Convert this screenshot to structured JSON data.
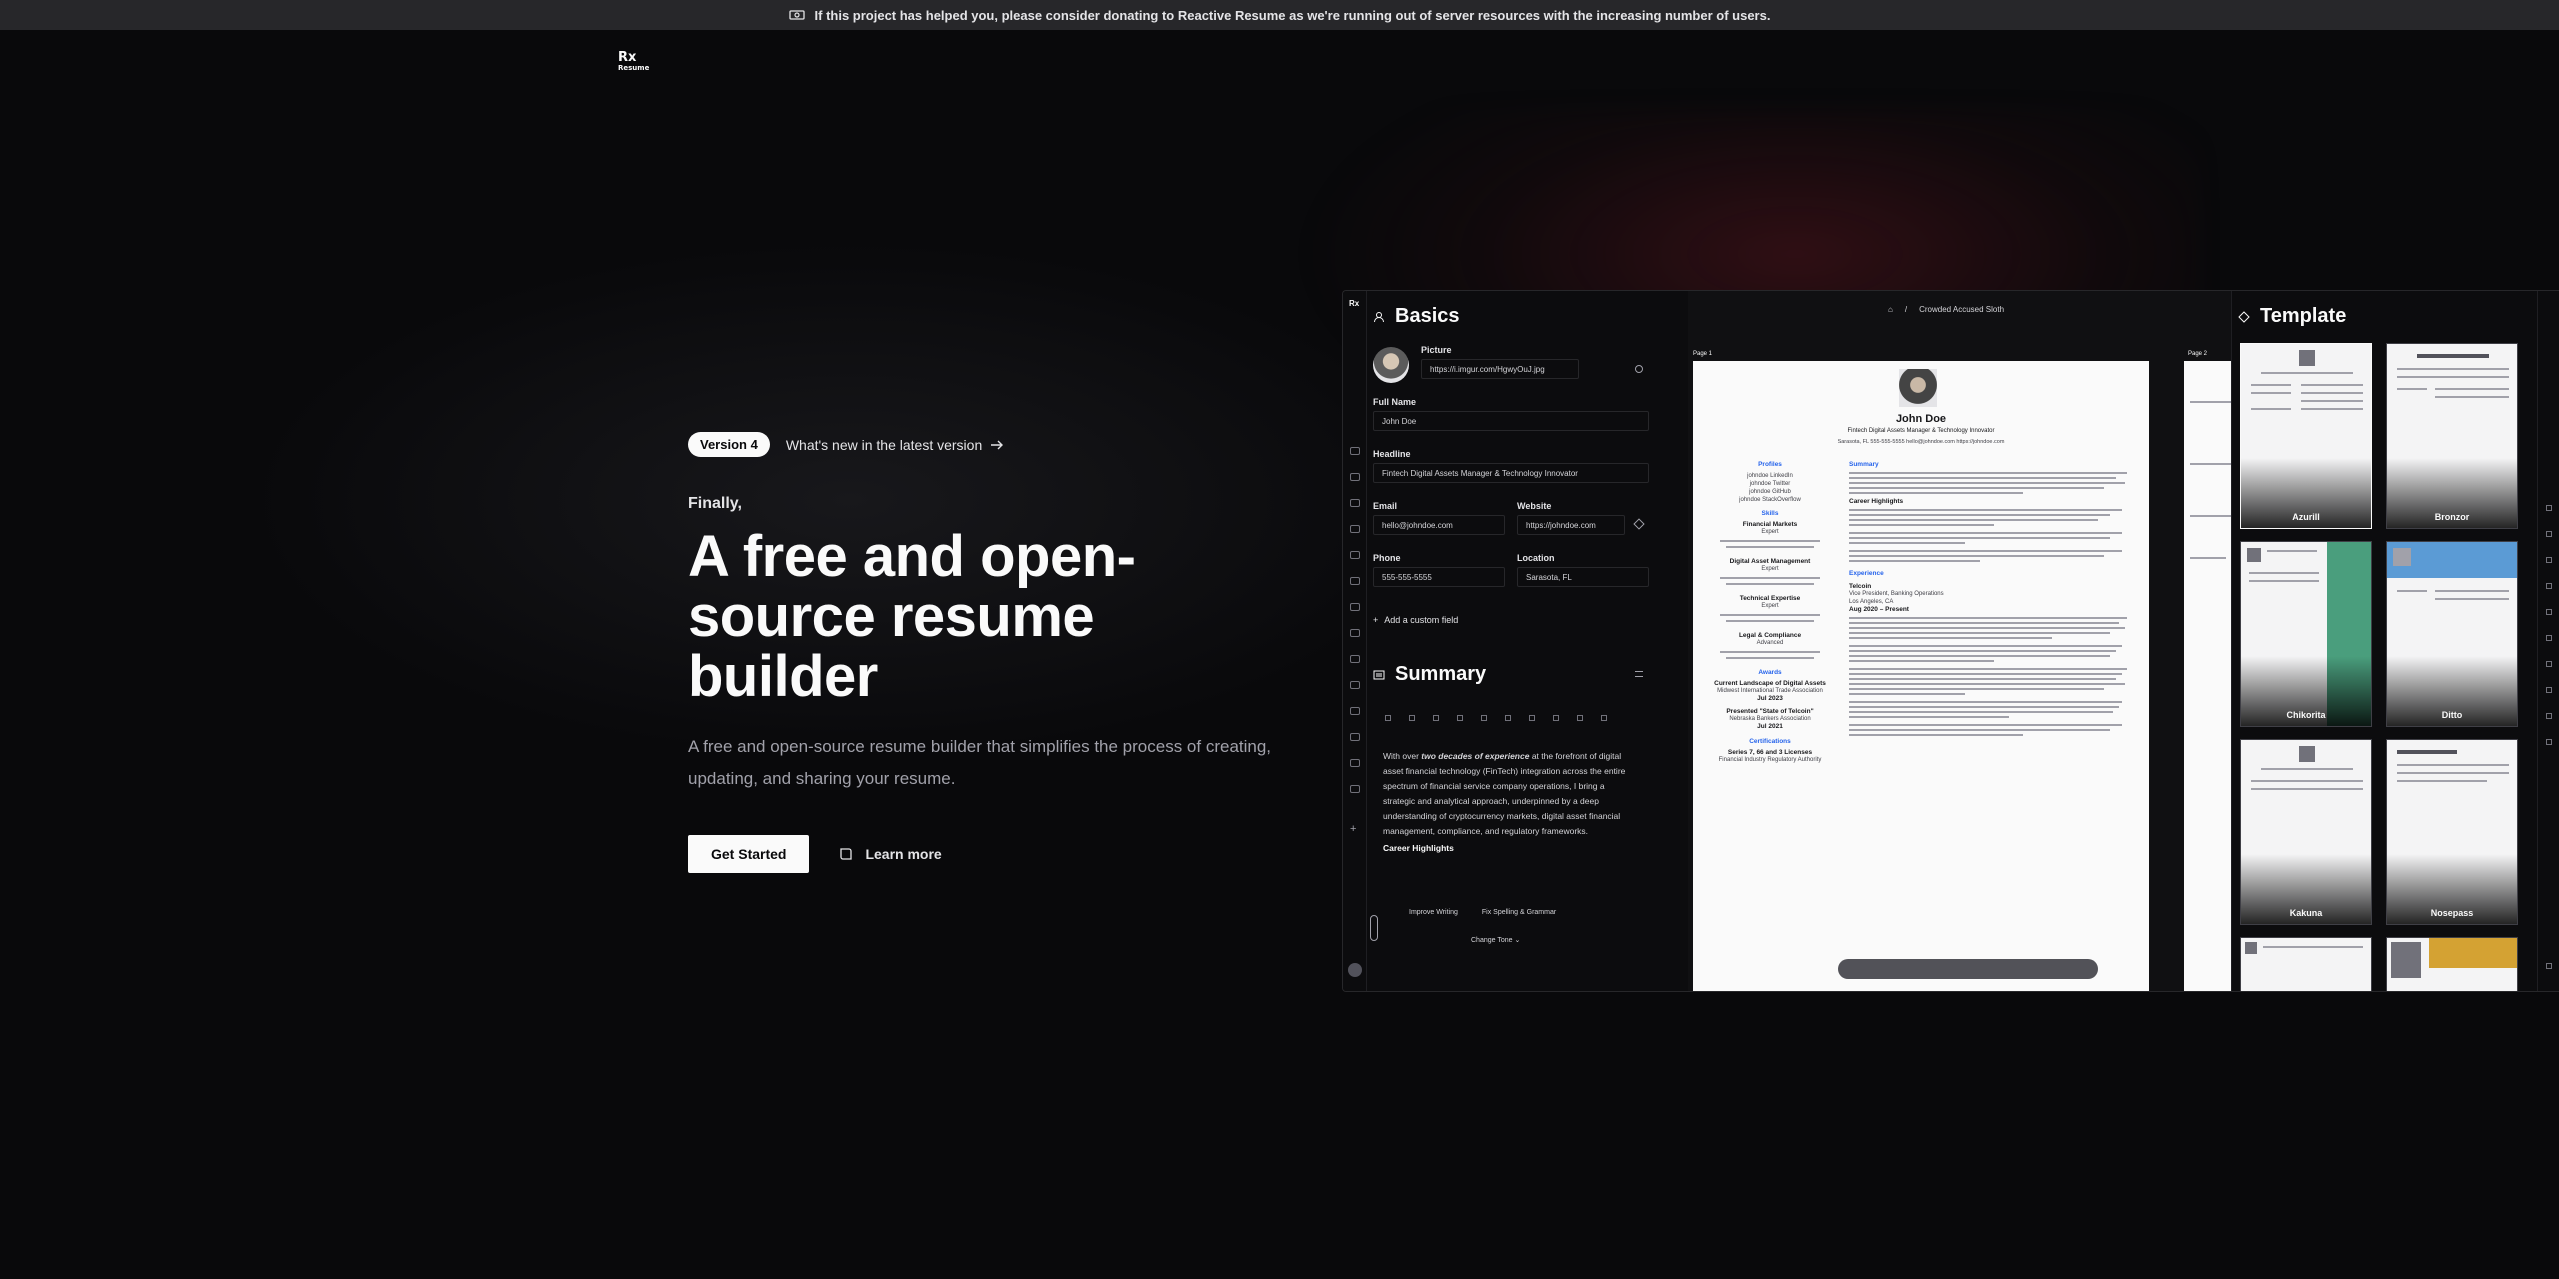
{
  "banner": {
    "text": "If this project has helped you, please consider donating to Reactive Resume as we're running out of server resources with the increasing number of users."
  },
  "logo": {
    "mark": "Rx",
    "word": "Resume"
  },
  "hero": {
    "version_badge": "Version 4",
    "version_link": "What's new in the latest version",
    "eyebrow": "Finally,",
    "headline": "A free and open-source resume builder",
    "subheadline": "A free and open-source resume builder that simplifies the process of creating, updating, and sharing your resume.",
    "primary_cta": "Get Started",
    "secondary_cta": "Learn more"
  },
  "preview": {
    "breadcrumb": "Crowded Accused Sloth",
    "basics": {
      "title": "Basics",
      "picture_label": "Picture",
      "picture_url": "https://i.imgur.com/HgwyOuJ.jpg",
      "full_name_label": "Full Name",
      "full_name": "John Doe",
      "headline_label": "Headline",
      "headline": "Fintech Digital Assets Manager & Technology Innovator",
      "email_label": "Email",
      "email": "hello@johndoe.com",
      "website_label": "Website",
      "website": "https://johndoe.com",
      "phone_label": "Phone",
      "phone": "555-555-5555",
      "location_label": "Location",
      "location": "Sarasota, FL",
      "add_custom": "Add a custom field"
    },
    "summary": {
      "title": "Summary",
      "body_pre": "With over ",
      "body_emph": "two decades of experience",
      "body_post": " at the forefront of digital asset financial technology (FinTech) integration across the entire spectrum of financial service company operations, I bring a strategic and analytical approach, underpinned by a deep understanding of cryptocurrency markets, digital asset financial management, compliance, and regulatory frameworks.",
      "highlights": "Career Highlights",
      "improve": "Improve Writing",
      "fix": "Fix Spelling & Grammar",
      "tone": "Change Tone"
    },
    "resume": {
      "page1": "Page 1",
      "page2": "Page 2",
      "name": "John Doe",
      "headline": "Fintech Digital Assets Manager & Technology Innovator",
      "contact": "Sarasota, FL   555-555-5555   hello@johndoe.com   https://johndoe.com",
      "profiles": "Profiles",
      "profile_items": [
        "johndoe LinkedIn",
        "johndoe Twitter",
        "johndoe GitHub",
        "johndoe StackOverflow"
      ],
      "skills": "Skills",
      "skill_items": [
        {
          "name": "Financial Markets",
          "level": "Expert"
        },
        {
          "name": "Digital Asset Management",
          "level": "Expert"
        },
        {
          "name": "Technical Expertise",
          "level": "Expert"
        },
        {
          "name": "Legal & Compliance",
          "level": "Advanced"
        }
      ],
      "awards": "Awards",
      "award_items": [
        {
          "title": "Current Landscape of Digital Assets",
          "org": "Midwest International Trade Association",
          "date": "Jul 2023"
        },
        {
          "title": "Presented \"State of Telcoin\"",
          "org": "Nebraska Bankers Association",
          "date": "Jul 2021"
        }
      ],
      "certifications": "Certifications",
      "cert_item": "Series 7, 66 and 3 Licenses",
      "cert_org": "Financial Industry Regulatory Authority",
      "summary_heading": "Summary",
      "career_highlights": "Career Highlights",
      "experience_heading": "Experience",
      "company": "Telcoin",
      "role": "Vice President, Banking Operations",
      "role_location": "Los Angeles, CA",
      "role_dates": "Aug 2020 – Present"
    },
    "templates": {
      "title": "Template",
      "items": [
        "Azurill",
        "Bronzor",
        "Chikorita",
        "Ditto",
        "Kakuna",
        "Nosepass"
      ]
    }
  },
  "colors": {
    "accent_green": "#4a9e7d",
    "accent_blue": "#5b9bd5",
    "accent_gold": "#d4a233",
    "background": "#09090b",
    "banner": "#27272a"
  }
}
